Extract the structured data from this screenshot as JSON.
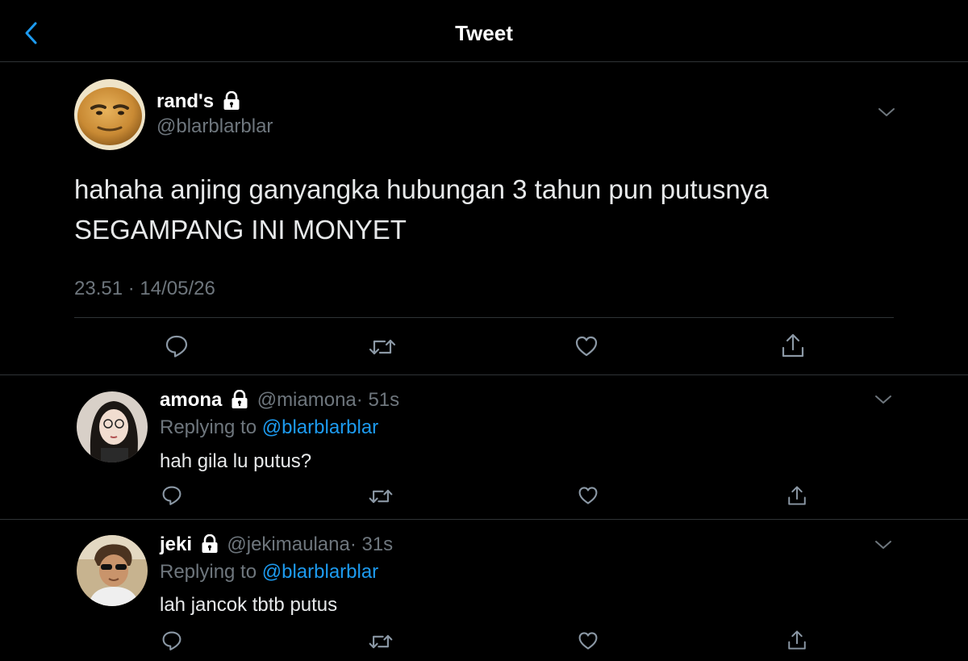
{
  "header": {
    "title": "Tweet"
  },
  "main_tweet": {
    "display_name": "rand's",
    "handle": "@blarblarblar",
    "text_line1": "hahaha anjing ganyangka hubungan 3 tahun pun putusnya",
    "text_line2": "SEGAMPANG INI MONYET",
    "timestamp": "23.51 · 14/05/26"
  },
  "replies": [
    {
      "display_name": "amona",
      "handle": "@miamona",
      "time": "· 51s",
      "replying_prefix": "Replying to",
      "replying_to": "@blarblarblar",
      "text": "hah gila lu putus?"
    },
    {
      "display_name": "jeki",
      "handle": "@jekimaulana",
      "time": "· 31s",
      "replying_prefix": "Replying to",
      "replying_to": "@blarblarblar",
      "text": "lah jancok tbtb putus"
    }
  ],
  "icons": [
    "back-chevron-icon",
    "lock-icon",
    "chevron-down-icon",
    "reply-icon",
    "retweet-icon",
    "like-icon",
    "share-icon"
  ],
  "colors": {
    "background": "#000000",
    "text": "#d9d9d9",
    "muted": "#6e767d",
    "link": "#1d9bf0",
    "divider": "#2f3336"
  }
}
